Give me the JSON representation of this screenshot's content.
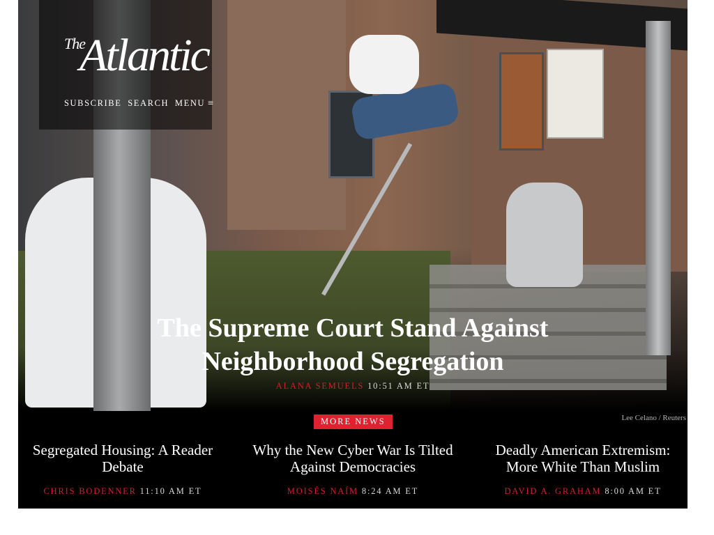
{
  "header": {
    "logo_the": "The",
    "logo_main": "Atlantic",
    "nav": {
      "subscribe": "SUBSCRIBE",
      "search": "SEARCH",
      "menu": "MENU",
      "menu_icon": "≡"
    }
  },
  "hero": {
    "headline": "The Supreme Court Stand Against Neighborhood Segregation",
    "author": "ALANA SEMUELS",
    "time": "10:51 AM ET",
    "photo_credit": "Lee Celano / Reuters"
  },
  "more_news": {
    "label": "MORE NEWS",
    "items": [
      {
        "title": "Segregated Housing: A Reader Debate",
        "author": "CHRIS BODENNER",
        "time": "11:10 AM ET"
      },
      {
        "title": "Why the New Cyber War Is Tilted Against Democracies",
        "author": "MOISÉS NAÍM",
        "time": "8:24 AM ET"
      },
      {
        "title": "Deadly American Extremism: More White Than Muslim",
        "author": "DAVID A. GRAHAM",
        "time": "8:00 AM ET"
      }
    ]
  },
  "colors": {
    "accent_red": "#e0212f",
    "background": "#000000",
    "text": "#ffffff"
  }
}
